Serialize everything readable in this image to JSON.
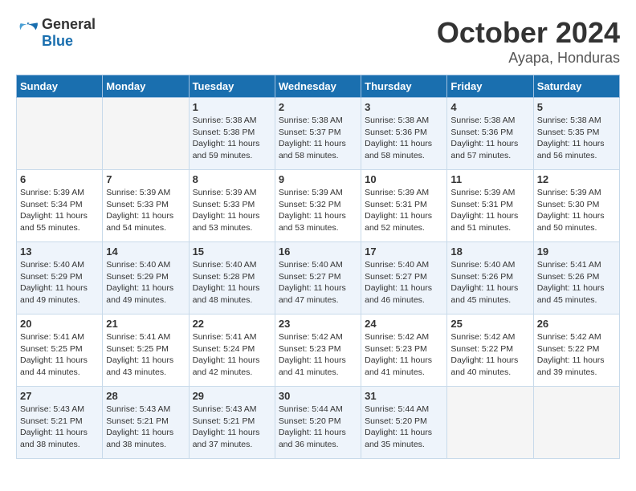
{
  "logo": {
    "general": "General",
    "blue": "Blue"
  },
  "title": "October 2024",
  "location": "Ayapa, Honduras",
  "weekdays": [
    "Sunday",
    "Monday",
    "Tuesday",
    "Wednesday",
    "Thursday",
    "Friday",
    "Saturday"
  ],
  "weeks": [
    [
      {
        "day": "",
        "info": ""
      },
      {
        "day": "",
        "info": ""
      },
      {
        "day": "1",
        "info": "Sunrise: 5:38 AM\nSunset: 5:38 PM\nDaylight: 11 hours and 59 minutes."
      },
      {
        "day": "2",
        "info": "Sunrise: 5:38 AM\nSunset: 5:37 PM\nDaylight: 11 hours and 58 minutes."
      },
      {
        "day": "3",
        "info": "Sunrise: 5:38 AM\nSunset: 5:36 PM\nDaylight: 11 hours and 58 minutes."
      },
      {
        "day": "4",
        "info": "Sunrise: 5:38 AM\nSunset: 5:36 PM\nDaylight: 11 hours and 57 minutes."
      },
      {
        "day": "5",
        "info": "Sunrise: 5:38 AM\nSunset: 5:35 PM\nDaylight: 11 hours and 56 minutes."
      }
    ],
    [
      {
        "day": "6",
        "info": "Sunrise: 5:39 AM\nSunset: 5:34 PM\nDaylight: 11 hours and 55 minutes."
      },
      {
        "day": "7",
        "info": "Sunrise: 5:39 AM\nSunset: 5:33 PM\nDaylight: 11 hours and 54 minutes."
      },
      {
        "day": "8",
        "info": "Sunrise: 5:39 AM\nSunset: 5:33 PM\nDaylight: 11 hours and 53 minutes."
      },
      {
        "day": "9",
        "info": "Sunrise: 5:39 AM\nSunset: 5:32 PM\nDaylight: 11 hours and 53 minutes."
      },
      {
        "day": "10",
        "info": "Sunrise: 5:39 AM\nSunset: 5:31 PM\nDaylight: 11 hours and 52 minutes."
      },
      {
        "day": "11",
        "info": "Sunrise: 5:39 AM\nSunset: 5:31 PM\nDaylight: 11 hours and 51 minutes."
      },
      {
        "day": "12",
        "info": "Sunrise: 5:39 AM\nSunset: 5:30 PM\nDaylight: 11 hours and 50 minutes."
      }
    ],
    [
      {
        "day": "13",
        "info": "Sunrise: 5:40 AM\nSunset: 5:29 PM\nDaylight: 11 hours and 49 minutes."
      },
      {
        "day": "14",
        "info": "Sunrise: 5:40 AM\nSunset: 5:29 PM\nDaylight: 11 hours and 49 minutes."
      },
      {
        "day": "15",
        "info": "Sunrise: 5:40 AM\nSunset: 5:28 PM\nDaylight: 11 hours and 48 minutes."
      },
      {
        "day": "16",
        "info": "Sunrise: 5:40 AM\nSunset: 5:27 PM\nDaylight: 11 hours and 47 minutes."
      },
      {
        "day": "17",
        "info": "Sunrise: 5:40 AM\nSunset: 5:27 PM\nDaylight: 11 hours and 46 minutes."
      },
      {
        "day": "18",
        "info": "Sunrise: 5:40 AM\nSunset: 5:26 PM\nDaylight: 11 hours and 45 minutes."
      },
      {
        "day": "19",
        "info": "Sunrise: 5:41 AM\nSunset: 5:26 PM\nDaylight: 11 hours and 45 minutes."
      }
    ],
    [
      {
        "day": "20",
        "info": "Sunrise: 5:41 AM\nSunset: 5:25 PM\nDaylight: 11 hours and 44 minutes."
      },
      {
        "day": "21",
        "info": "Sunrise: 5:41 AM\nSunset: 5:25 PM\nDaylight: 11 hours and 43 minutes."
      },
      {
        "day": "22",
        "info": "Sunrise: 5:41 AM\nSunset: 5:24 PM\nDaylight: 11 hours and 42 minutes."
      },
      {
        "day": "23",
        "info": "Sunrise: 5:42 AM\nSunset: 5:23 PM\nDaylight: 11 hours and 41 minutes."
      },
      {
        "day": "24",
        "info": "Sunrise: 5:42 AM\nSunset: 5:23 PM\nDaylight: 11 hours and 41 minutes."
      },
      {
        "day": "25",
        "info": "Sunrise: 5:42 AM\nSunset: 5:22 PM\nDaylight: 11 hours and 40 minutes."
      },
      {
        "day": "26",
        "info": "Sunrise: 5:42 AM\nSunset: 5:22 PM\nDaylight: 11 hours and 39 minutes."
      }
    ],
    [
      {
        "day": "27",
        "info": "Sunrise: 5:43 AM\nSunset: 5:21 PM\nDaylight: 11 hours and 38 minutes."
      },
      {
        "day": "28",
        "info": "Sunrise: 5:43 AM\nSunset: 5:21 PM\nDaylight: 11 hours and 38 minutes."
      },
      {
        "day": "29",
        "info": "Sunrise: 5:43 AM\nSunset: 5:21 PM\nDaylight: 11 hours and 37 minutes."
      },
      {
        "day": "30",
        "info": "Sunrise: 5:44 AM\nSunset: 5:20 PM\nDaylight: 11 hours and 36 minutes."
      },
      {
        "day": "31",
        "info": "Sunrise: 5:44 AM\nSunset: 5:20 PM\nDaylight: 11 hours and 35 minutes."
      },
      {
        "day": "",
        "info": ""
      },
      {
        "day": "",
        "info": ""
      }
    ]
  ]
}
